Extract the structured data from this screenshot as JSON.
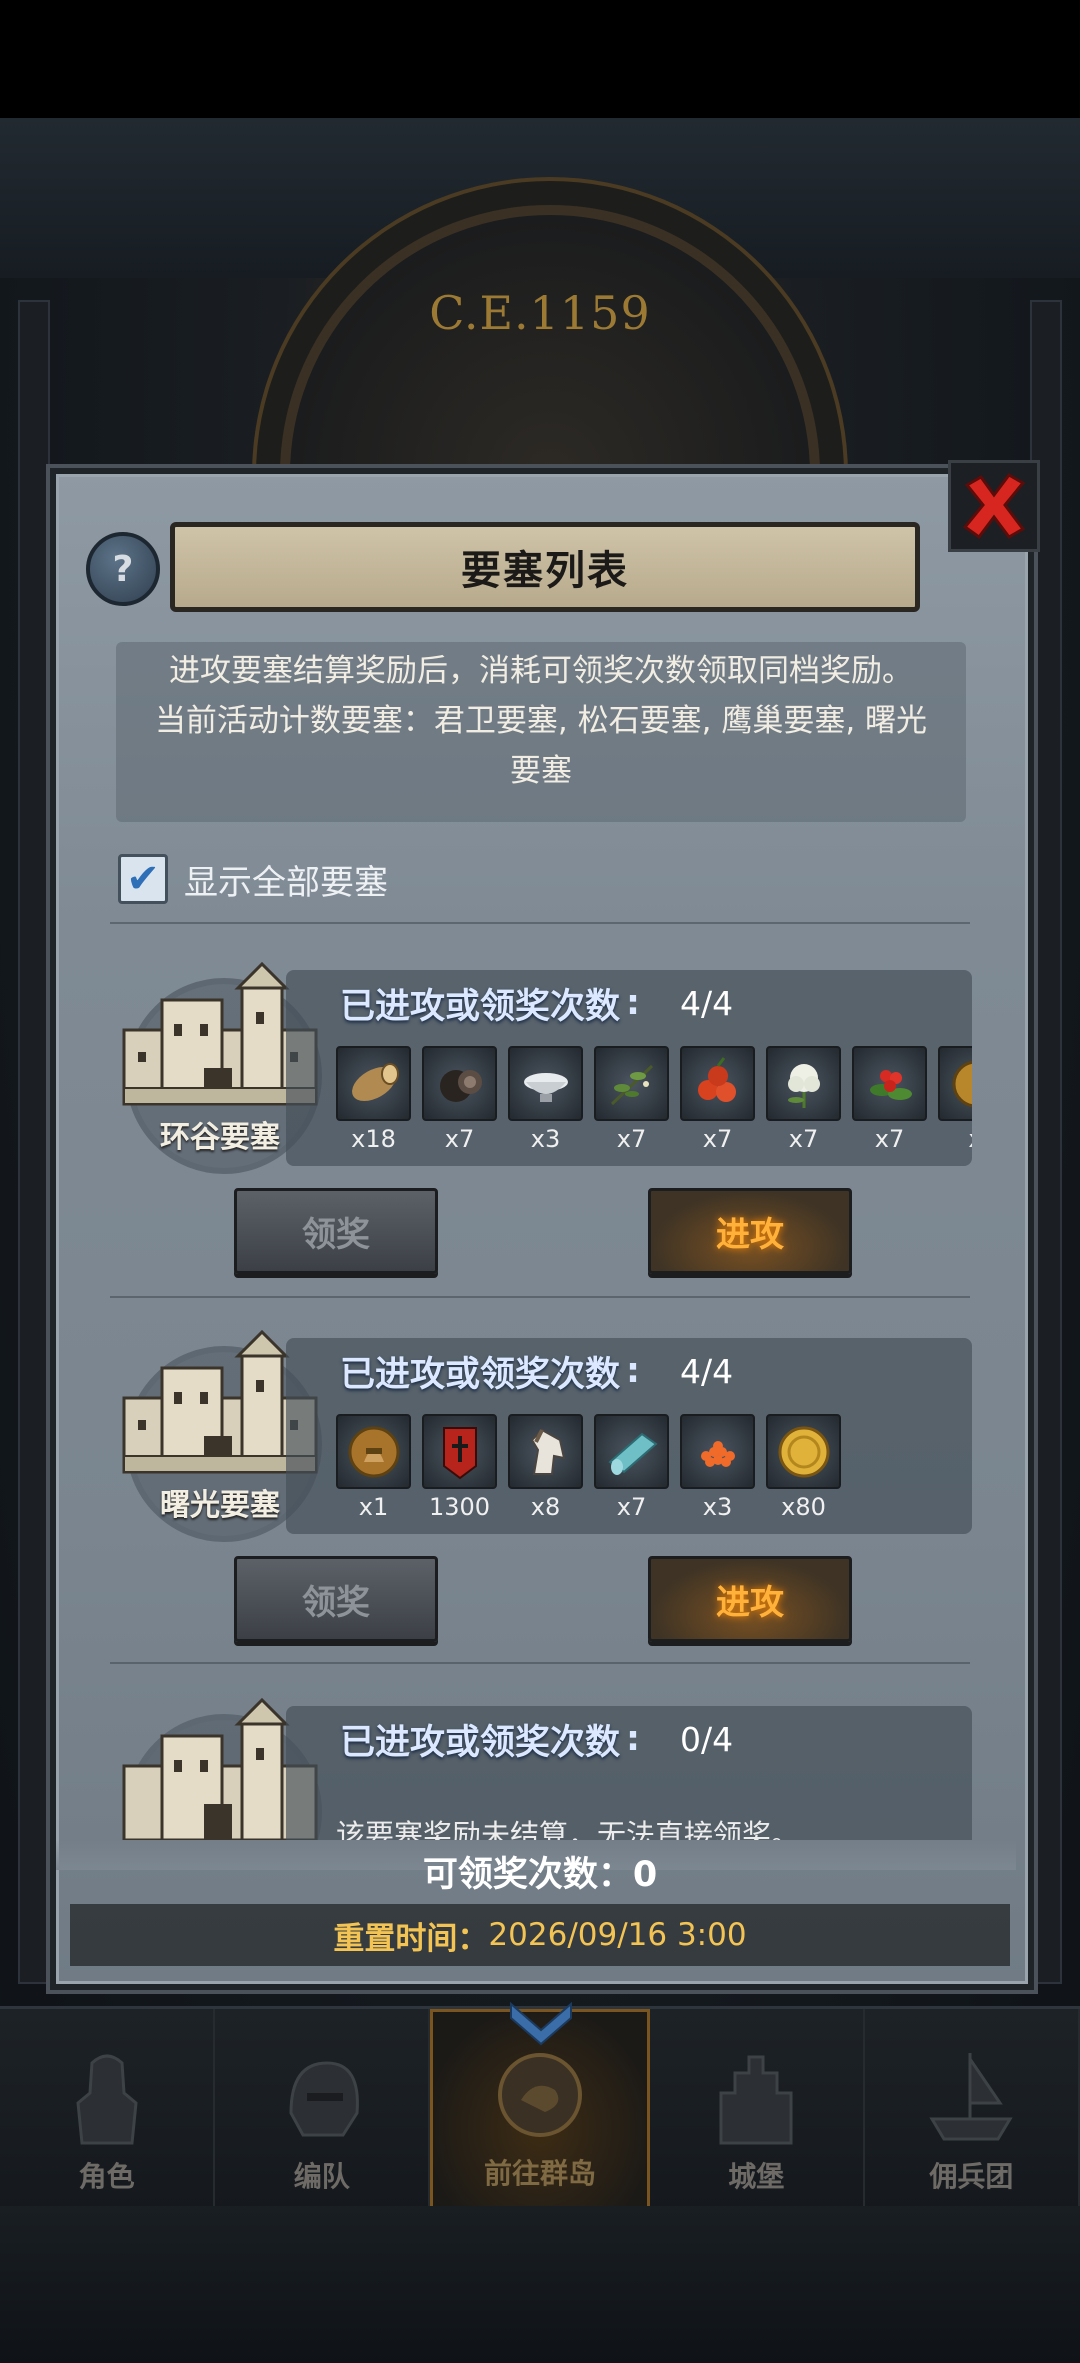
{
  "background": {
    "era_label": "C.E.1159"
  },
  "dialog": {
    "title": "要塞列表",
    "notice": [
      "进攻要塞结算奖励后，消耗可领奖次数领取同档奖励。",
      "当前活动计数要塞：君卫要塞, 松石要塞, 鹰巢要塞, 曙光",
      "要塞"
    ],
    "show_all_label": "显示全部要塞",
    "show_all_checked": "✔",
    "help_glyph": "?",
    "count_label": "已进攻或领奖次数",
    "count_colon": ":",
    "claim_label": "领奖",
    "attack_label": "进攻",
    "claimable_text": "可领奖次数：0",
    "reset_label": "重置时间：",
    "reset_value": "2026/09/16 3:00"
  },
  "fortresses": [
    {
      "name": "环谷要塞",
      "count": "4/4",
      "rewards": [
        {
          "icon": "log-icon",
          "qty": "x18"
        },
        {
          "icon": "truffle-icon",
          "qty": "x7"
        },
        {
          "icon": "salt-bowl-icon",
          "qty": "x3"
        },
        {
          "icon": "herb-sprig-icon",
          "qty": "x7"
        },
        {
          "icon": "red-berries-icon",
          "qty": "x7"
        },
        {
          "icon": "white-flower-icon",
          "qty": "x7"
        },
        {
          "icon": "holly-berries-icon",
          "qty": "x7"
        },
        {
          "icon": "coin-icon",
          "qty": "x"
        }
      ]
    },
    {
      "name": "曙光要塞",
      "count": "4/4",
      "rewards": [
        {
          "icon": "knight-medal-icon",
          "qty": "x1"
        },
        {
          "icon": "red-banner-icon",
          "qty": "1300"
        },
        {
          "icon": "horse-icon",
          "qty": "x8"
        },
        {
          "icon": "cloth-roll-icon",
          "qty": "x7"
        },
        {
          "icon": "caviar-icon",
          "qty": "x3"
        },
        {
          "icon": "gold-coin-icon",
          "qty": "x80"
        }
      ]
    },
    {
      "name": "",
      "count": "0/4",
      "locked_message": "该要塞奖励未结算，无法直接领奖。",
      "rewards": []
    }
  ],
  "bottom_nav": [
    {
      "label": "角色",
      "icon": "knight-icon",
      "active": false
    },
    {
      "label": "编队",
      "icon": "helmet-icon",
      "active": false
    },
    {
      "label": "前往群岛",
      "icon": "island-map-icon",
      "active": true
    },
    {
      "label": "城堡",
      "icon": "castle-icon",
      "active": false
    },
    {
      "label": "佣兵团",
      "icon": "ship-icon",
      "active": false
    }
  ],
  "colors": {
    "attack_text": "#ffb13a",
    "reset_text": "#f3c453",
    "count_label": "#dbe8ff",
    "close_red": "#d7261f"
  }
}
